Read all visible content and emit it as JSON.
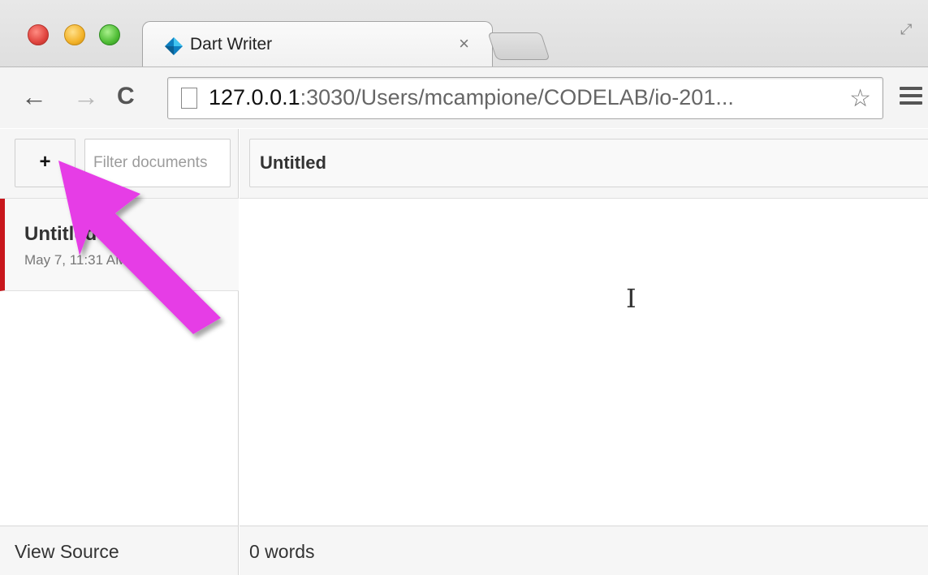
{
  "browser": {
    "tab_title": "Dart Writer",
    "tab_close": "×",
    "url_host": "127.0.0.1",
    "url_rest": ":3030/Users/mcampione/CODELAB/io-201...",
    "back_icon": "←",
    "forward_icon": "→",
    "reload_icon": "C",
    "star_icon": "☆",
    "fullscreen_icon": "⤢"
  },
  "sidebar": {
    "add_label": "+",
    "filter_placeholder": "Filter documents",
    "documents": [
      {
        "title": "Untitled",
        "date": "May 7, 11:31 AM"
      }
    ]
  },
  "editor": {
    "title": "Untitled",
    "cursor_icon": "I"
  },
  "status": {
    "view_source": "View Source",
    "word_count": "0 words"
  },
  "colors": {
    "accent_selected": "#c8171c",
    "annotation_arrow": "#e63de6"
  }
}
